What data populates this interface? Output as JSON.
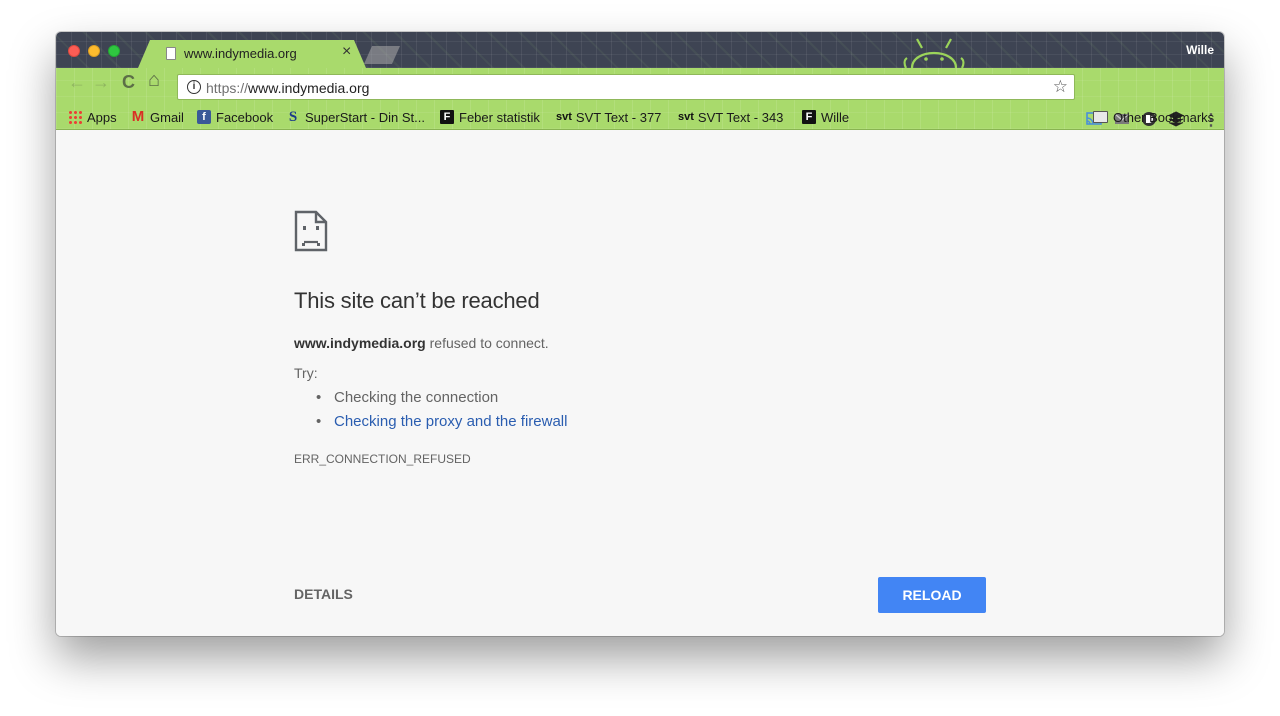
{
  "window": {
    "profile_name": "Wille"
  },
  "tab": {
    "title": "www.indymedia.org",
    "close_glyph": "×"
  },
  "toolbar": {
    "back_glyph": "←",
    "forward_glyph": "→",
    "reload_glyph": "C",
    "home_glyph": "⌂",
    "info_glyph": "i",
    "url_scheme": "https://",
    "url_host": "www.indymedia.org",
    "star_glyph": "☆",
    "menu_glyph": "⋮"
  },
  "bookmarks": [
    {
      "label": "Apps",
      "icon": "apps-grid-icon"
    },
    {
      "label": "Gmail",
      "icon": "gmail-icon",
      "glyph": "M"
    },
    {
      "label": "Facebook",
      "icon": "facebook-icon",
      "glyph": "f"
    },
    {
      "label": "SuperStart - Din St...",
      "icon": "superstart-icon",
      "glyph": "S"
    },
    {
      "label": "Feber statistik",
      "icon": "feber-icon",
      "glyph": "F"
    },
    {
      "label": "SVT Text - 377",
      "icon": "svt-icon",
      "glyph": "svt"
    },
    {
      "label": "SVT Text - 343",
      "icon": "svt-icon",
      "glyph": "svt"
    },
    {
      "label": "Wille",
      "icon": "feber-icon",
      "glyph": "F"
    }
  ],
  "other_bookmarks": "Other Bookmarks",
  "error_page": {
    "heading": "This site can’t be reached",
    "host": "www.indymedia.org",
    "desc_suffix": " refused to connect.",
    "try_label": "Try:",
    "suggestions": [
      "Checking the connection",
      "Checking the proxy and the firewall"
    ],
    "error_code": "ERR_CONNECTION_REFUSED",
    "details_label": "DETAILS",
    "reload_label": "RELOAD"
  },
  "colors": {
    "theme_green": "#a9da6c",
    "titlebar_dark": "#3e4453",
    "link_blue": "#2a5db0",
    "button_blue": "#4285f4"
  }
}
